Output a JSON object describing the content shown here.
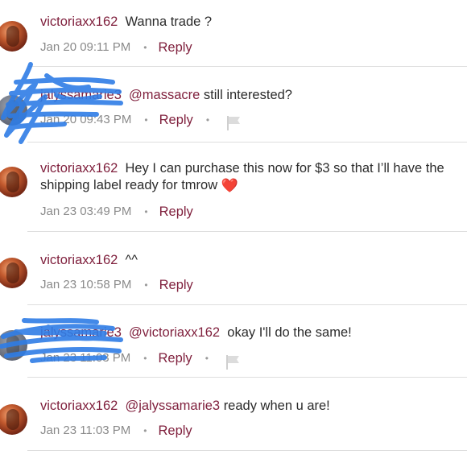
{
  "comments": [
    {
      "username": "victoriaxx162",
      "mention": "",
      "text": "Wanna trade ?",
      "text2": "",
      "timestamp": "Jan 20 09:11 PM",
      "reply_label": "Reply",
      "dot": "•",
      "show_flag": false
    },
    {
      "username": "jalyssamarie3",
      "mention": "@massacre",
      "text": "still interested?",
      "text2": "",
      "timestamp": "Jan 20 09:43 PM",
      "reply_label": "Reply",
      "dot": "•",
      "show_flag": true
    },
    {
      "username": "victoriaxx162",
      "mention": "",
      "text": "Hey I can purchase this now for $3 so that I’ll have the",
      "text2": "shipping label ready for tmrow",
      "timestamp": "Jan 23 03:49 PM",
      "reply_label": "Reply",
      "dot": "•",
      "show_flag": false
    },
    {
      "username": "victoriaxx162",
      "mention": "",
      "text": "^^",
      "text2": "",
      "timestamp": "Jan 23 10:58 PM",
      "reply_label": "Reply",
      "dot": "•",
      "show_flag": false
    },
    {
      "username": "jalyssamarie3",
      "mention": "@victoriaxx162",
      "text": "okay I'll do the same!",
      "text2": "",
      "timestamp": "Jan 23 11:03 PM",
      "reply_label": "Reply",
      "dot": "•",
      "show_flag": true
    },
    {
      "username": "victoriaxx162",
      "mention": "@jalyssamarie3",
      "text": "ready when u are!",
      "text2": "",
      "timestamp": "Jan 23 11:03 PM",
      "reply_label": "Reply",
      "dot": "•",
      "show_flag": false
    }
  ],
  "heart_glyph": "❤️",
  "colors": {
    "username": "#7f1f3c",
    "text": "#2b2b2b",
    "meta": "#8a8a8a",
    "scribble": "#2f7de6"
  }
}
